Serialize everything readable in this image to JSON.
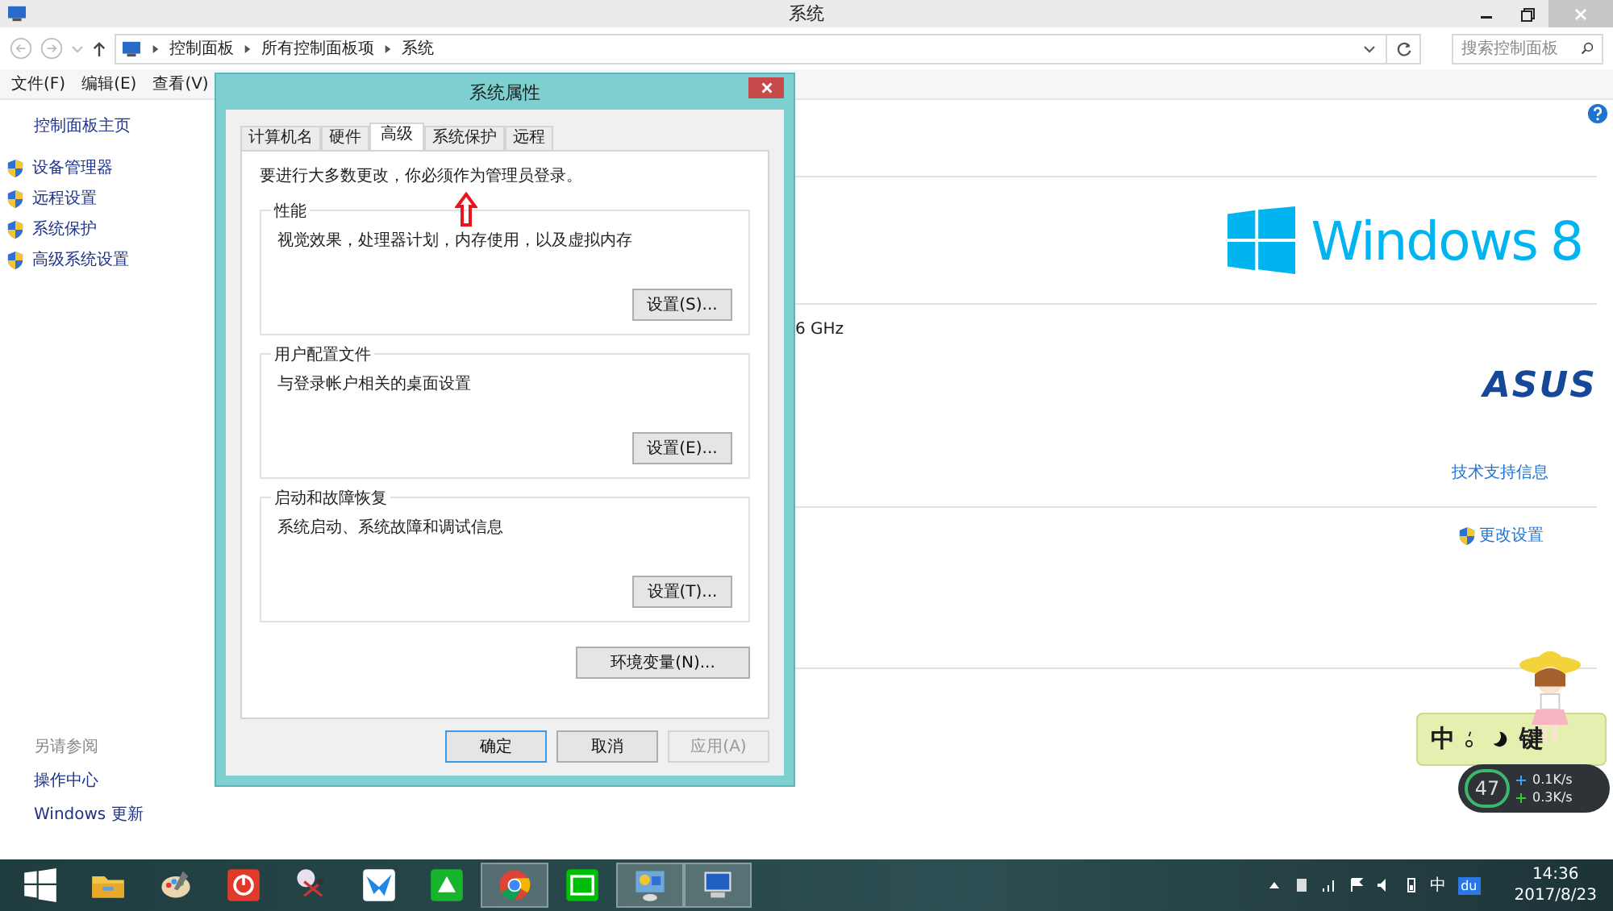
{
  "window": {
    "title": "系统",
    "breadcrumb": [
      "控制面板",
      "所有控制面板项",
      "系统"
    ],
    "search": {
      "placeholder": "搜索控制面板"
    }
  },
  "menu": [
    "文件(F)",
    "编辑(E)",
    "查看(V)"
  ],
  "sidebar": {
    "home": "控制面板主页",
    "items": [
      "设备管理器",
      "远程设置",
      "系统保护",
      "高级系统设置"
    ],
    "see_also": "另请参阅",
    "links": [
      "操作中心",
      "Windows 更新"
    ]
  },
  "content": {
    "os_logo": {
      "name": "Windows",
      "version": "8"
    },
    "cpu_fragment": "6 GHz",
    "maker_logo": "ASUS",
    "support_link": "技术支持信息",
    "change_settings": "更改设置"
  },
  "dialog": {
    "title": "系统属性",
    "tabs": [
      {
        "label": "计算机名",
        "selected": false
      },
      {
        "label": "硬件",
        "selected": false
      },
      {
        "label": "高级",
        "selected": true
      },
      {
        "label": "系统保护",
        "selected": false
      },
      {
        "label": "远程",
        "selected": false
      }
    ],
    "note": "要进行大多数更改，你必须作为管理员登录。",
    "groups": [
      {
        "title": "性能",
        "description": "视觉效果，处理器计划，内存使用，以及虚拟内存",
        "button": "设置(S)..."
      },
      {
        "title": "用户配置文件",
        "description": "与登录帐户相关的桌面设置",
        "button": "设置(E)..."
      },
      {
        "title": "启动和故障恢复",
        "description": "系统启动、系统故障和调试信息",
        "button": "设置(T)..."
      }
    ],
    "env_button": "环境变量(N)...",
    "buttons": [
      {
        "label": "确定",
        "default": true,
        "disabled": false
      },
      {
        "label": "取消",
        "default": false,
        "disabled": false
      },
      {
        "label": "应用(A)",
        "default": false,
        "disabled": true
      }
    ]
  },
  "ime": {
    "mode": "中",
    "key": "键",
    "gauge": "47",
    "upload": "0.1K/s",
    "download": "0.3K/s"
  },
  "taskbar": {
    "apps": [
      {
        "kind": "start",
        "active": false
      },
      {
        "kind": "folder",
        "active": false
      },
      {
        "kind": "palette",
        "active": false
      },
      {
        "kind": "power",
        "active": false
      },
      {
        "kind": "scissors",
        "active": false
      },
      {
        "kind": "bird",
        "active": false
      },
      {
        "kind": "green",
        "active": false
      },
      {
        "kind": "chrome",
        "active": true
      },
      {
        "kind": "video",
        "active": false
      },
      {
        "kind": "control",
        "active": true
      },
      {
        "kind": "monitor",
        "active": true
      }
    ],
    "ime_mode": "中",
    "tray_app": "du",
    "time": "14:36",
    "date": "2017/8/23"
  }
}
